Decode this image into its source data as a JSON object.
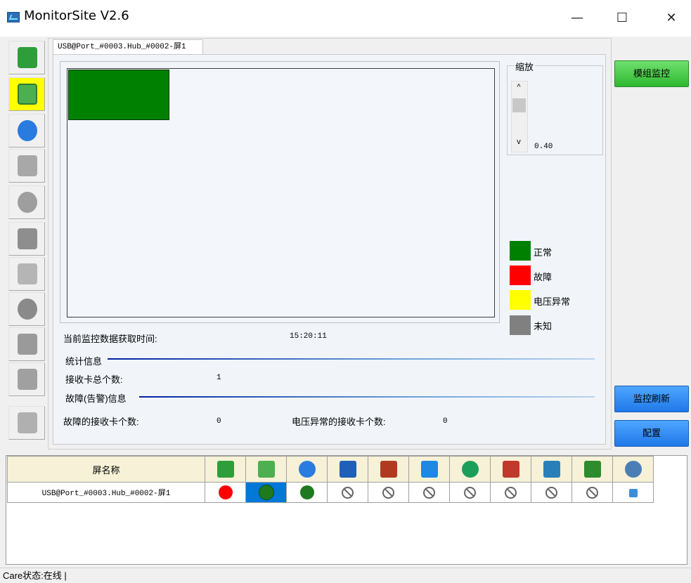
{
  "window": {
    "title": "MonitorSite V2.6",
    "minimize": "—",
    "maximize": "☐",
    "close": "✕"
  },
  "sidebar": {
    "items": [
      {
        "icon": "receiving-card-icon",
        "color": "#2e9e3a"
      },
      {
        "icon": "module-icon",
        "color": "#4caf50",
        "active": true
      },
      {
        "icon": "temperature-icon",
        "color": "#2a7be0"
      },
      {
        "icon": "cabinet-icon",
        "color": "#9a9a9a"
      },
      {
        "icon": "humidity-icon",
        "color": "#a0a0a0"
      },
      {
        "icon": "smoke-icon",
        "color": "#9a9a9a"
      },
      {
        "icon": "fan-icon",
        "color": "#b0b0b0"
      },
      {
        "icon": "voltage-icon",
        "color": "#9a9a9a"
      },
      {
        "icon": "magnet-icon",
        "color": "#9a9a9a"
      },
      {
        "icon": "door-icon",
        "color": "#9a9a9a"
      },
      {
        "icon": "led-grid-icon",
        "color": "#9a9a9a"
      }
    ]
  },
  "tab": {
    "label": "USB@Port_#0003.Hub_#0002-屏1"
  },
  "zoom": {
    "label": "缩放",
    "value": "0.40"
  },
  "legend": [
    {
      "label": "正常",
      "color": "#008000"
    },
    {
      "label": "故障",
      "color": "#ff0000"
    },
    {
      "label": "电压异常",
      "color": "#ffff00"
    },
    {
      "label": "未知",
      "color": "#808080"
    }
  ],
  "info": {
    "time_label": "当前监控数据获取时间:",
    "time_value": "15:20:11",
    "stats_header": "统计信息",
    "total_cards_label": "接收卡总个数:",
    "total_cards_value": "1",
    "fault_header": "故障(告警)信息",
    "fault_cards_label": "故障的接收卡个数:",
    "fault_cards_value": "0",
    "voltage_cards_label": "电压异常的接收卡个数:",
    "voltage_cards_value": "0"
  },
  "buttons": {
    "module_monitor": "模组监控",
    "refresh": "监控刷新",
    "config": "配置"
  },
  "table": {
    "header_name": "屏名称",
    "columns": [
      {
        "icon": "receiving-card-icon",
        "color": "#2e9e3a"
      },
      {
        "icon": "module-icon",
        "color": "#4caf50"
      },
      {
        "icon": "temperature-icon",
        "color": "#2a7be0"
      },
      {
        "icon": "cabinet-icon",
        "color": "#1f5fb8"
      },
      {
        "icon": "smoke-icon",
        "color": "#b03a20"
      },
      {
        "icon": "fan-icon",
        "color": "#1e88e5"
      },
      {
        "icon": "voltage-icon",
        "color": "#1b9e5a"
      },
      {
        "icon": "magnet-icon",
        "color": "#c0392b"
      },
      {
        "icon": "door-icon",
        "color": "#2980b9"
      },
      {
        "icon": "led-grid-icon",
        "color": "#2e8b2e"
      },
      {
        "icon": "globe-icon",
        "color": "#4a7fb5"
      }
    ],
    "rows": [
      {
        "name": "USB@Port_#0003.Hub_#0002-屏1",
        "cells": [
          "red-dot",
          "green-dot-selected",
          "green-dot",
          "ban",
          "ban",
          "ban",
          "ban",
          "ban",
          "ban",
          "ban",
          "small-icon"
        ]
      }
    ]
  },
  "status_bar": {
    "text": "Care状态:在线 |"
  }
}
